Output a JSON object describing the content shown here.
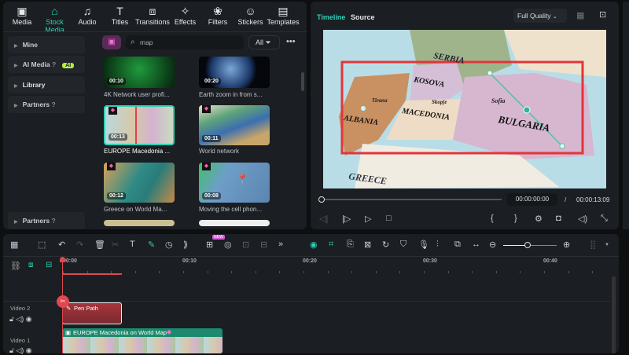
{
  "tabs": [
    {
      "label": "Media",
      "icon": "media-icon"
    },
    {
      "label": "Stock Media",
      "icon": "stock-media-icon",
      "active": true
    },
    {
      "label": "Audio",
      "icon": "music-note-icon"
    },
    {
      "label": "Titles",
      "icon": "title-t-icon"
    },
    {
      "label": "Transitions",
      "icon": "transitions-icon"
    },
    {
      "label": "Effects",
      "icon": "effects-star-icon"
    },
    {
      "label": "Filters",
      "icon": "filters-icon"
    },
    {
      "label": "Stickers",
      "icon": "stickers-icon"
    },
    {
      "label": "Templates",
      "icon": "templates-icon"
    }
  ],
  "sidebar": {
    "items": [
      {
        "label": "Mine"
      },
      {
        "label": "AI Media",
        "badge": "AI"
      },
      {
        "label": "Library"
      },
      {
        "label": "Partners"
      }
    ],
    "bottom": "Partners"
  },
  "search": {
    "value": "map",
    "filter": "All"
  },
  "media": [
    {
      "title": "4K Network user profi...",
      "duration": "00:10"
    },
    {
      "title": "Earth zoom in from s...",
      "duration": "00:20"
    },
    {
      "title": "EUROPE Macedonia ...",
      "duration": "00:13"
    },
    {
      "title": "World network",
      "duration": "00:11"
    },
    {
      "title": "Greece on World Ma...",
      "duration": "00:12"
    },
    {
      "title": "Moving the cell phon...",
      "duration": "00:08"
    }
  ],
  "preview": {
    "tab_timeline": "Timeline",
    "tab_source": "Source",
    "quality": "Full Quality",
    "current_time": "00:00:00:00",
    "separator": "/",
    "total_time": "00:00:13:09",
    "map_labels": {
      "serbia": "SERBIA",
      "kosova": "KOSOVA",
      "albania": "ALBANIA",
      "macedonia": "MACEDONIA",
      "skopje": "Skopje",
      "tirana": "Tirana",
      "sofia": "Sofia",
      "bulgaria": "BULGARIA",
      "greece": "GREECE"
    }
  },
  "timeline": {
    "ruler": [
      "00:00",
      "00:10",
      "00:20",
      "00:30",
      "00:40"
    ],
    "zoom_level": 0.45,
    "new_badge": "NEW",
    "tracks": [
      {
        "name": "Video 2",
        "clip": "Pen Path"
      },
      {
        "name": "Video 1",
        "clip": "EUROPE Macedonia on World Map"
      }
    ]
  },
  "colors": {
    "accent": "#2fd0b5",
    "playhead": "#e0484f",
    "pen_clip": "#a8343c",
    "video_clip": "#1c8a6e"
  }
}
